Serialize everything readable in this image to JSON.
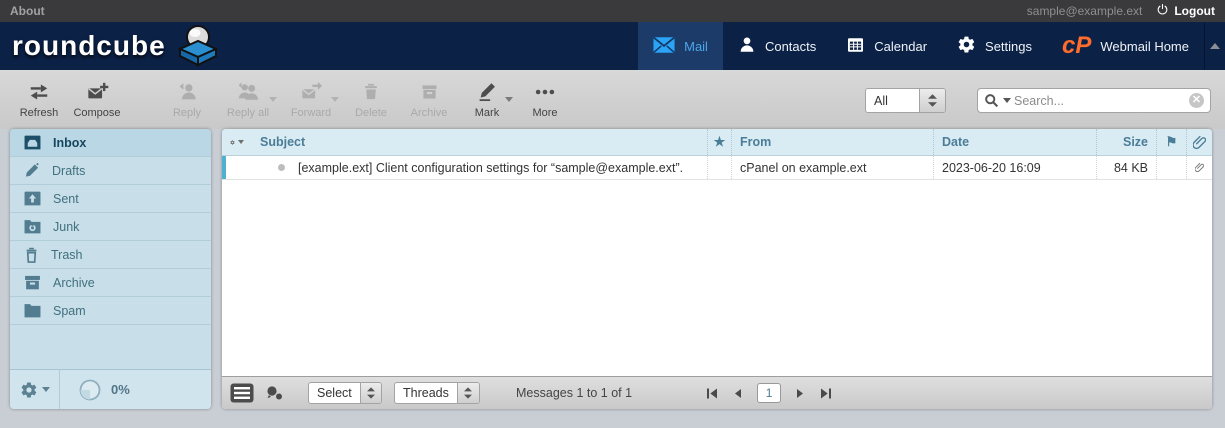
{
  "topbar": {
    "about": "About",
    "user": "sample@example.ext",
    "logout": "Logout"
  },
  "nav": {
    "brand": "roundcube",
    "items": [
      {
        "label": "Mail",
        "active": true
      },
      {
        "label": "Contacts",
        "active": false
      },
      {
        "label": "Calendar",
        "active": false
      },
      {
        "label": "Settings",
        "active": false
      },
      {
        "label": "Webmail Home",
        "active": false
      }
    ],
    "cpanel_logo": "cP"
  },
  "toolbar": {
    "buttons": [
      {
        "label": "Refresh",
        "enabled": true
      },
      {
        "label": "Compose",
        "enabled": true
      },
      {
        "label": "Reply",
        "enabled": false
      },
      {
        "label": "Reply all",
        "enabled": false,
        "caret": true
      },
      {
        "label": "Forward",
        "enabled": false,
        "caret": true
      },
      {
        "label": "Delete",
        "enabled": false
      },
      {
        "label": "Archive",
        "enabled": false
      },
      {
        "label": "Mark",
        "enabled": true,
        "caret": true
      },
      {
        "label": "More",
        "enabled": true
      }
    ],
    "filter_value": "All",
    "search_placeholder": "Search..."
  },
  "sidebar": {
    "folders": [
      "Inbox",
      "Drafts",
      "Sent",
      "Junk",
      "Trash",
      "Archive",
      "Spam"
    ],
    "selected_folder": "Inbox",
    "quota": "0%"
  },
  "list": {
    "columns": {
      "subject": "Subject",
      "from": "From",
      "date": "Date",
      "size": "Size"
    },
    "messages": [
      {
        "subject": "[example.ext] Client configuration settings for “sample@example.ext”.",
        "from": "cPanel on example.ext",
        "date": "2023-06-20 16:09",
        "size": "84 KB",
        "has_attachment": true
      }
    ]
  },
  "listfooter": {
    "select_label": "Select",
    "threads_label": "Threads",
    "status": "Messages 1 to 1 of 1",
    "page": "1"
  },
  "icons": {
    "star": "★",
    "flag": "⚑"
  },
  "colors": {
    "navy": "#0c2146",
    "active_tab": "#1c3b68",
    "mail_icon_blue": "#2ba3f7",
    "cpanel_orange": "#ff6c2c",
    "sidebar_bg": "#c8dee9",
    "list_header_bg": "#d9ebf3",
    "focus_bar": "#4fb0d0"
  }
}
